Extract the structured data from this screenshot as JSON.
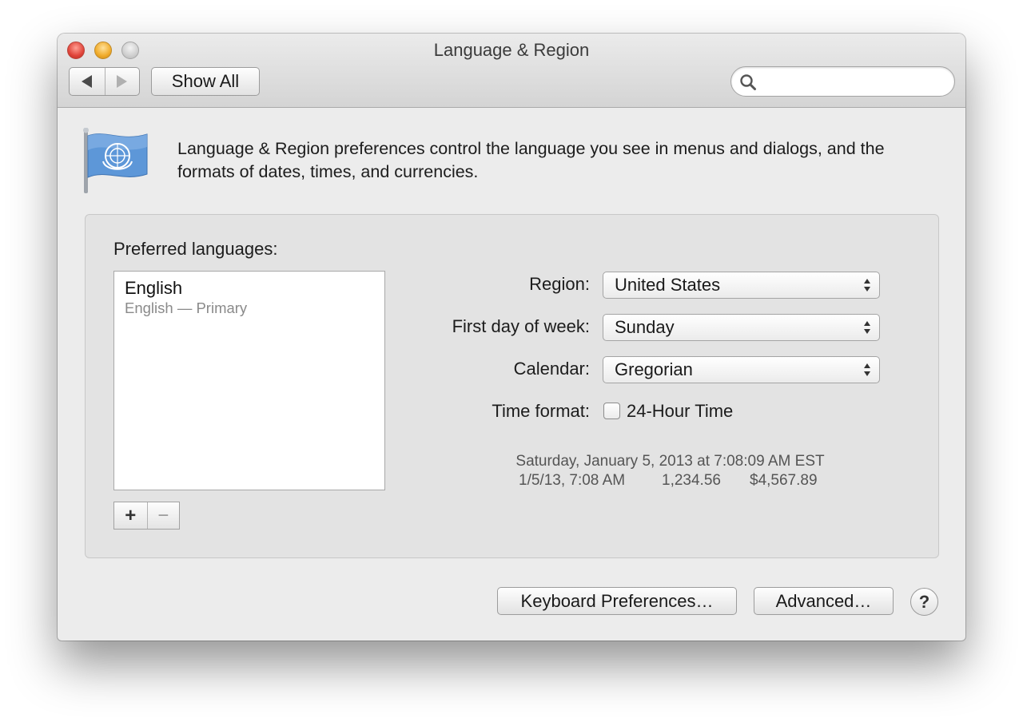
{
  "window": {
    "title": "Language & Region"
  },
  "toolbar": {
    "back_icon": "triangle-left-icon",
    "forward_icon": "triangle-right-icon",
    "show_all_label": "Show All",
    "search_placeholder": "",
    "search_value": ""
  },
  "header": {
    "icon": "un-flag-icon",
    "description": "Language & Region preferences control the language you see in menus and dialogs, and the formats of dates, times, and currencies."
  },
  "languages": {
    "label": "Preferred languages:",
    "items": [
      {
        "name": "English",
        "detail": "English — Primary"
      }
    ],
    "add_label": "+",
    "remove_label": "−"
  },
  "settings": {
    "region": {
      "label": "Region:",
      "value": "United States"
    },
    "first_day": {
      "label": "First day of week:",
      "value": "Sunday"
    },
    "calendar": {
      "label": "Calendar:",
      "value": "Gregorian"
    },
    "time_format": {
      "label": "Time format:",
      "checkbox_label": "24-Hour Time",
      "checked": false
    }
  },
  "sample": {
    "long_date": "Saturday, January 5, 2013 at 7:08:09 AM EST",
    "short_date": "1/5/13, 7:08 AM",
    "number": "1,234.56",
    "currency": "$4,567.89"
  },
  "footer": {
    "keyboard_label": "Keyboard Preferences…",
    "advanced_label": "Advanced…",
    "help_label": "?"
  },
  "colors": {
    "window_bg": "#ececec",
    "flag_blue": "#4f8fd6"
  }
}
